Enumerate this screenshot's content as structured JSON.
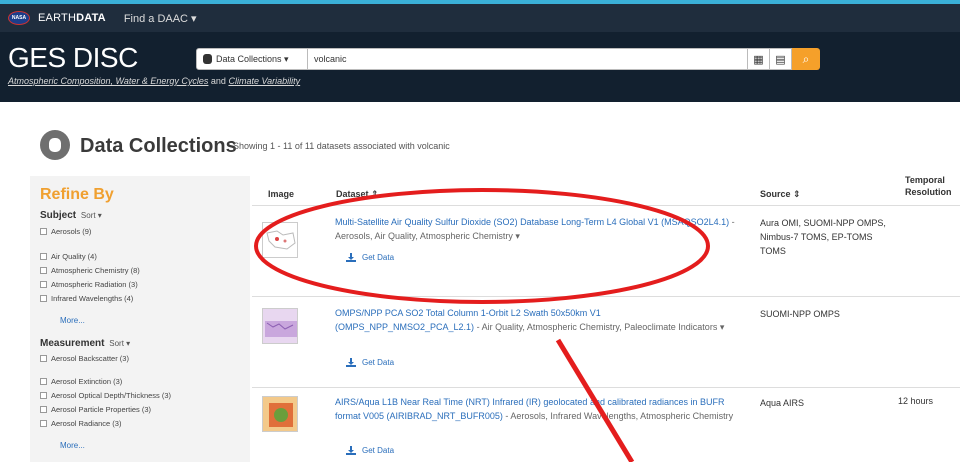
{
  "topbar": {
    "logo": "NASA",
    "brand_bold": "EARTH",
    "brand_bold2": "DATA",
    "find_daac": "Find a DAAC ▾"
  },
  "header": {
    "title": "GES DISC",
    "tagline_part1": "Atmospheric Composition, Water & Energy Cycles",
    "tagline_and": " and ",
    "tagline_part2": "Climate Variability",
    "select_label": "Data Collections ▾",
    "search_value": "volcanic",
    "calendar_icon": "▦",
    "map_icon": "▤",
    "search_icon": "⌕"
  },
  "page": {
    "title": "Data Collections",
    "showing": "Showing 1 - 11 of 11 datasets associated with volcanic"
  },
  "sidebar": {
    "refine": "Refine By",
    "subject": {
      "title": "Subject",
      "sort": "Sort ▾",
      "items": [
        "Aerosols (9)",
        "Air Quality (4)",
        "Atmospheric Chemistry (8)",
        "Atmospheric Radiation (3)",
        "Infrared Wavelengths (4)"
      ],
      "more": "More..."
    },
    "measurement": {
      "title": "Measurement",
      "sort": "Sort ▾",
      "items": [
        "Aerosol Backscatter (3)",
        "Aerosol Extinction (3)",
        "Aerosol Optical Depth/Thickness (3)",
        "Aerosol Particle Properties (3)",
        "Aerosol Radiance (3)"
      ],
      "more": "More..."
    }
  },
  "table": {
    "headers": {
      "image": "Image",
      "dataset": "Dataset ⇕",
      "source": "Source ⇕",
      "temporal1": "Temporal",
      "temporal2": "Resolution"
    },
    "rows": [
      {
        "title": "Multi-Satellite Air Quality Sulfur Dioxide (SO2) Database Long-Term L4 Global V1 (MSAQSO2L4.1)",
        "tags": " - Aerosols, Air Quality, Atmospheric Chemistry ▾",
        "get_data": "Get Data",
        "source": "Aura OMI, SUOMI-NPP OMPS, Nimbus-7 TOMS, EP-TOMS TOMS",
        "temporal": ""
      },
      {
        "title": "OMPS/NPP PCA SO2 Total Column 1-Orbit L2 Swath 50x50km V1 (OMPS_NPP_NMSO2_PCA_L2.1)",
        "tags": " - Air Quality, Atmospheric Chemistry, Paleoclimate Indicators ▾",
        "get_data": "Get Data",
        "source": "SUOMI-NPP OMPS",
        "temporal": ""
      },
      {
        "title": "AIRS/Aqua L1B Near Real Time (NRT) Infrared (IR) geolocated and calibrated radiances in BUFR format V005 (AIRIBRAD_NRT_BUFR005)",
        "tags": " - Aerosols, Infrared Wavelengths, Atmospheric Chemistry",
        "get_data": "Get Data",
        "source": "Aqua AIRS",
        "temporal": "12 hours"
      }
    ]
  },
  "colors": {
    "accent": "#f5a02a",
    "link": "#2a6ebb",
    "annotation": "#e41d1d",
    "header_bg": "#12202f"
  }
}
